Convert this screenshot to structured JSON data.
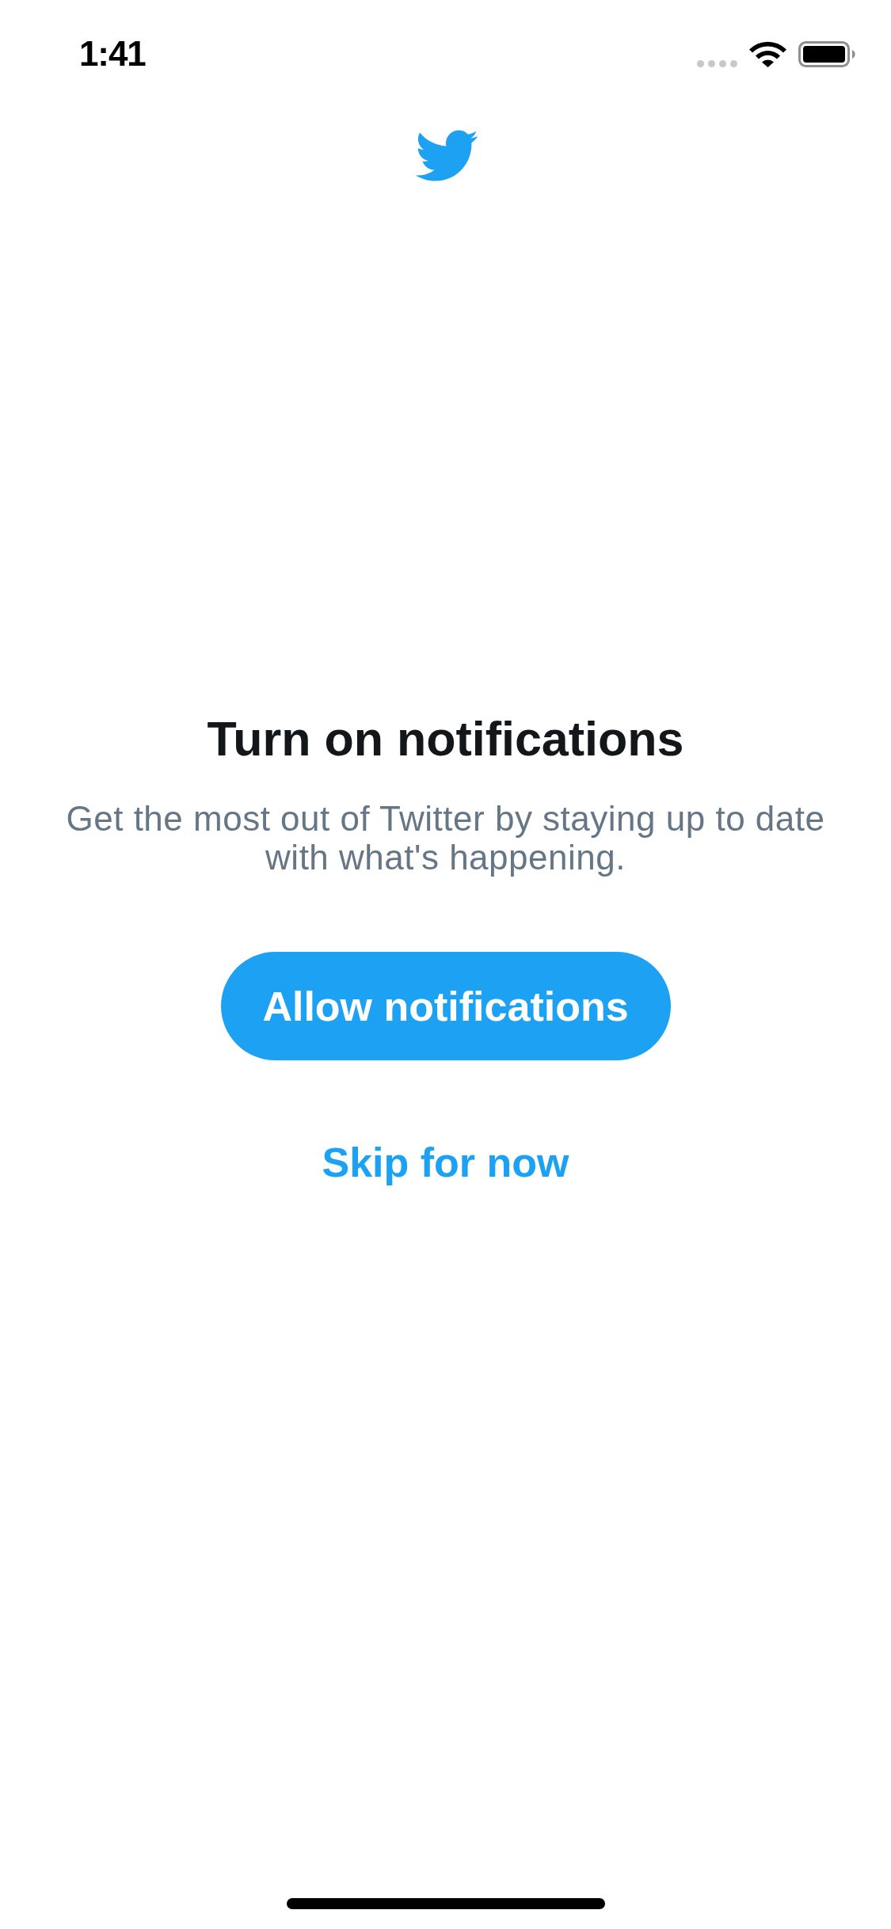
{
  "status_bar": {
    "time": "1:41"
  },
  "title": "Turn on notifications",
  "subtitle": "Get the most out of Twitter by staying up to date with what's happening.",
  "buttons": [
    {
      "kind": "primary",
      "label": "Allow notifications"
    },
    {
      "kind": "link",
      "label": "Skip for now"
    }
  ]
}
